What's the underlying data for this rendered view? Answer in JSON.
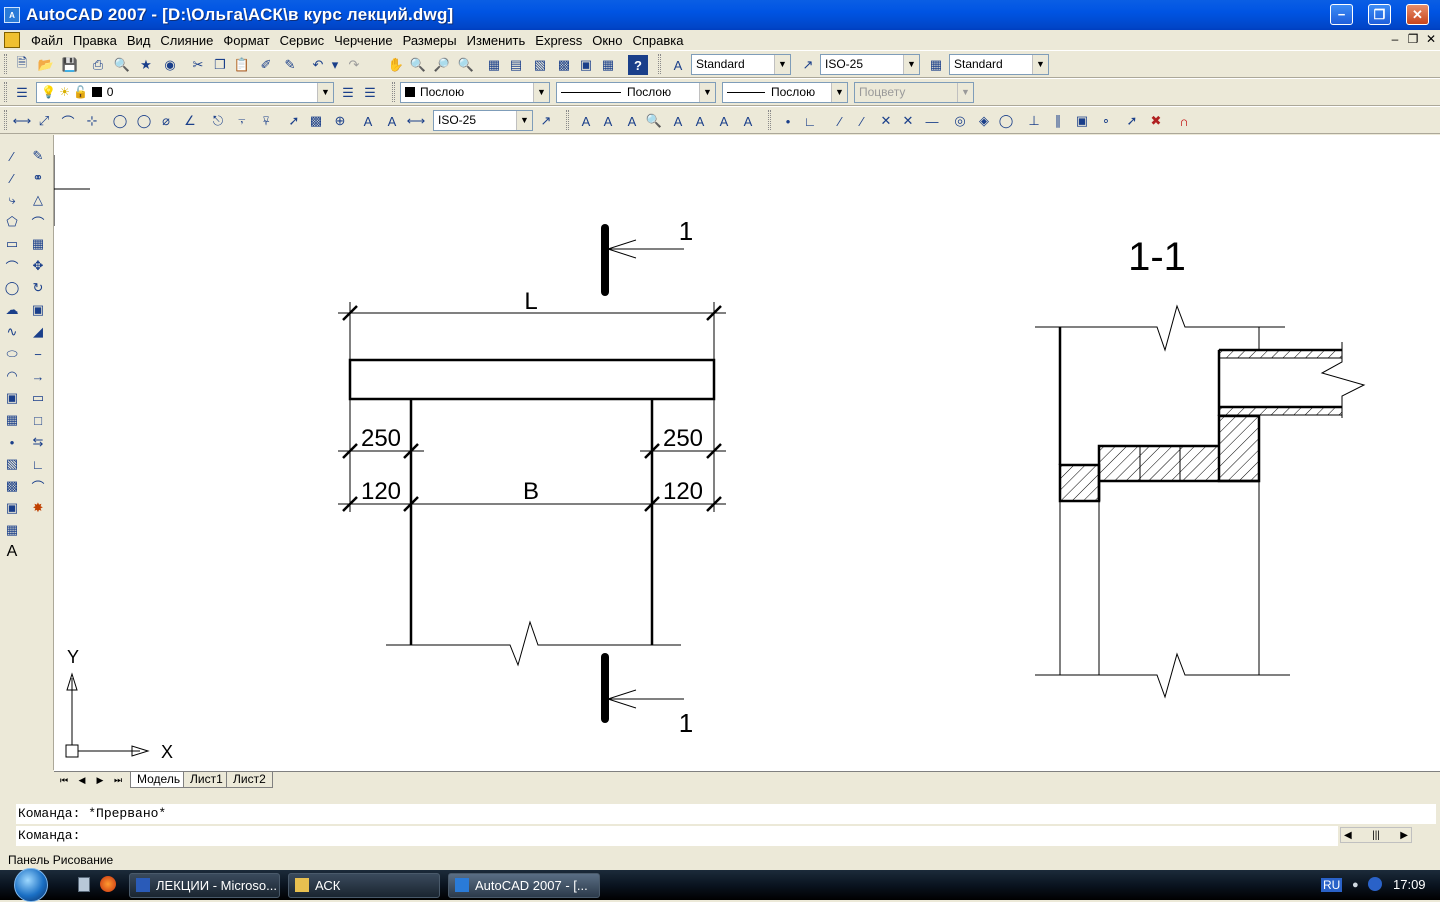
{
  "window": {
    "title": "AutoCAD 2007 - [D:\\Ольга\\АСК\\в курс лекций.dwg]",
    "minimize": "−",
    "maximize": "❐",
    "close": "✕"
  },
  "menu": {
    "items": [
      "Файл",
      "Правка",
      "Вид",
      "Слияние",
      "Формат",
      "Сервис",
      "Черчение",
      "Размеры",
      "Изменить",
      "Express",
      "Окно",
      "Справка"
    ]
  },
  "toolbar_styles": {
    "text_style": "Standard",
    "dim_style": "ISO-25",
    "table_style": "Standard"
  },
  "toolbar_layers": {
    "layer_name": "0",
    "color": "Послою",
    "linetype": "Послою",
    "lineweight": "Послою",
    "plot_style": "Поцвету"
  },
  "toolbar_dims": {
    "dim_style": "ISO-25"
  },
  "drawing": {
    "plan": {
      "top_label": "L",
      "width_label": "B",
      "dim_250_left": "250",
      "dim_250_right": "250",
      "dim_120_left": "120",
      "dim_120_right": "120",
      "section_mark_top": "1",
      "section_mark_bottom": "1"
    },
    "section": {
      "title": "1-1"
    },
    "ucs": {
      "x_label": "X",
      "y_label": "Y"
    }
  },
  "layout_tabs": [
    "Модель",
    "Лист1",
    "Лист2"
  ],
  "command": {
    "history": "Команда: *Прервано*",
    "prompt": "Команда:"
  },
  "status": {
    "text": "Панель Рисование"
  },
  "taskbar": {
    "buttons": [
      "ЛЕКЦИИ - Microso...",
      "АСК",
      "AutoCAD 2007 - [..."
    ],
    "language": "RU",
    "clock": "17:09"
  },
  "colors": {
    "titlebar": "#0054e3",
    "chrome": "#ece9d8",
    "canvas": "#ffffff"
  }
}
